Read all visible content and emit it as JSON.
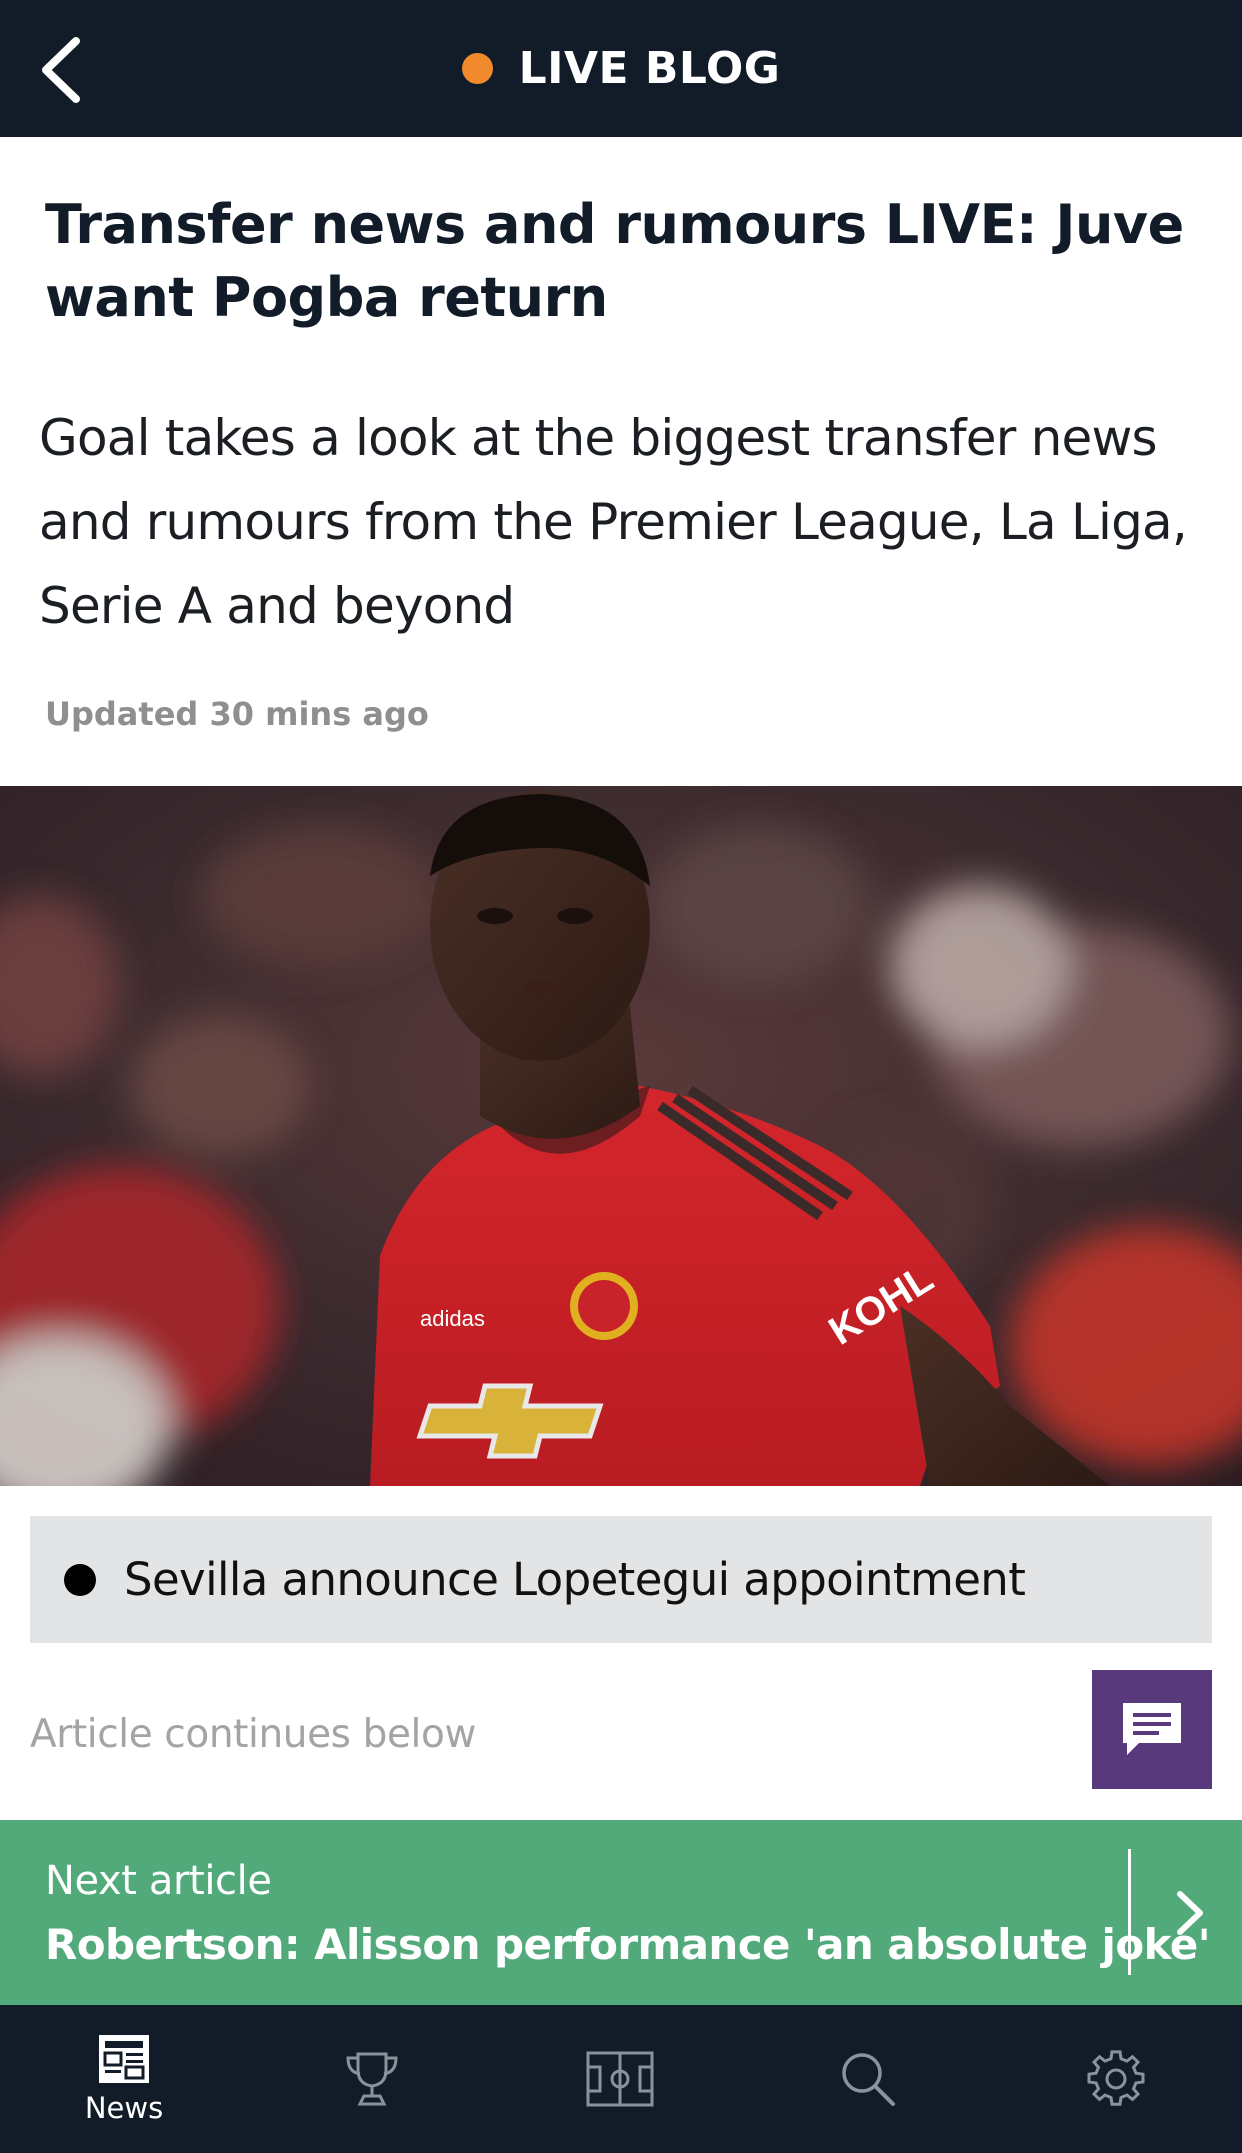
{
  "header": {
    "back_icon": "back-chevron-icon",
    "title": "LIVE BLOG",
    "live_dot_color": "#f08a2c",
    "bg_color": "#111c28"
  },
  "article": {
    "headline": "Transfer news and rumours LIVE: Juve want Pogba return",
    "standfirst": "Goal takes a look at the biggest transfer news and rumours from the Premier League, La Liga, Serie A and beyond",
    "updated": "Updated 30 mins ago",
    "hero_image": "photo-of-footballer-in-red-kit",
    "hero_shirt_text": "KOHL"
  },
  "key_event": {
    "text": "Sevilla announce Lopetegui appointment"
  },
  "continues_text": "Article continues below",
  "comment_button": {
    "icon": "comment-icon",
    "color": "#57397c"
  },
  "next_article": {
    "label": "Next article",
    "title": "Robertson: Alisson performance 'an absolute joke'",
    "icon": "chevron-right-icon",
    "color": "#52aa7b"
  },
  "bottom_nav": {
    "items": [
      {
        "label": "News",
        "icon": "news-icon",
        "active": true
      },
      {
        "label": "",
        "icon": "trophy-icon",
        "active": false
      },
      {
        "label": "",
        "icon": "pitch-icon",
        "active": false
      },
      {
        "label": "",
        "icon": "search-icon",
        "active": false
      },
      {
        "label": "",
        "icon": "gear-icon",
        "active": false
      }
    ]
  }
}
